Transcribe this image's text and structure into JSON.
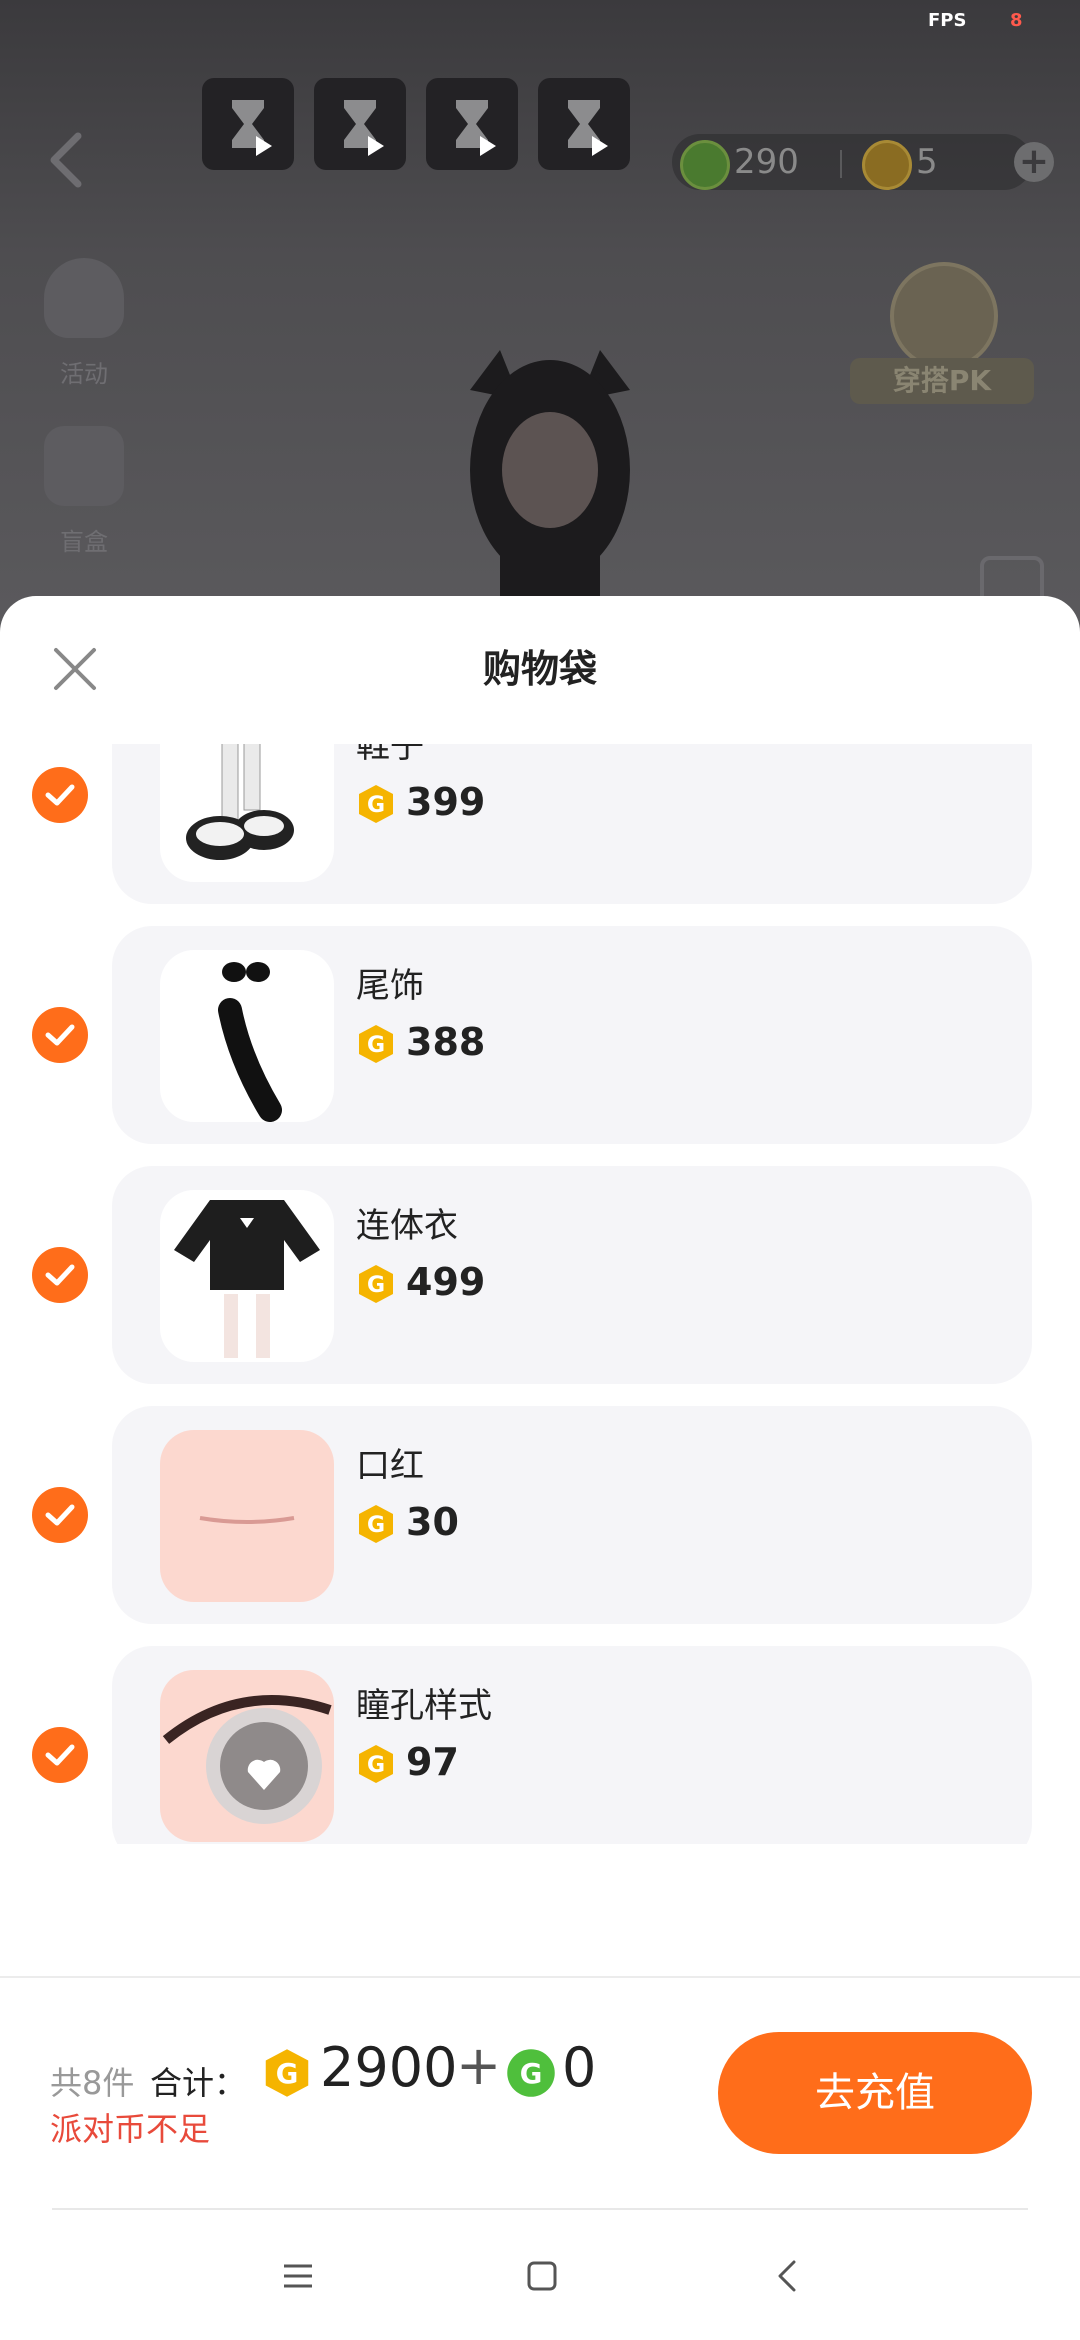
{
  "status": {
    "fps_label": "FPS",
    "fps_value": "8"
  },
  "background": {
    "currency_green": "290",
    "currency_gold": "5",
    "side_items": [
      {
        "label": "活动"
      },
      {
        "label": "盲盒"
      }
    ],
    "pk_badge_label": "穿搭PK"
  },
  "cart": {
    "title": "购物袋",
    "items": [
      {
        "name": "鞋子",
        "price": "399",
        "selected": true
      },
      {
        "name": "尾饰",
        "price": "388",
        "selected": true
      },
      {
        "name": "连体衣",
        "price": "499",
        "selected": true
      },
      {
        "name": "口红",
        "price": "30",
        "selected": true
      },
      {
        "name": "瞳孔样式",
        "price": "97",
        "selected": true
      }
    ],
    "footer": {
      "count_text": "共8件",
      "total_label": "合计：",
      "gold_total": "2900",
      "plus": "+",
      "green_total": "0",
      "warning": "派对币不足",
      "recharge_label": "去充值"
    }
  },
  "colors": {
    "accent": "#ff6d1a",
    "warning": "#e84a3b",
    "coin_gold": "#f5b400",
    "coin_green": "#4fbf3c"
  }
}
